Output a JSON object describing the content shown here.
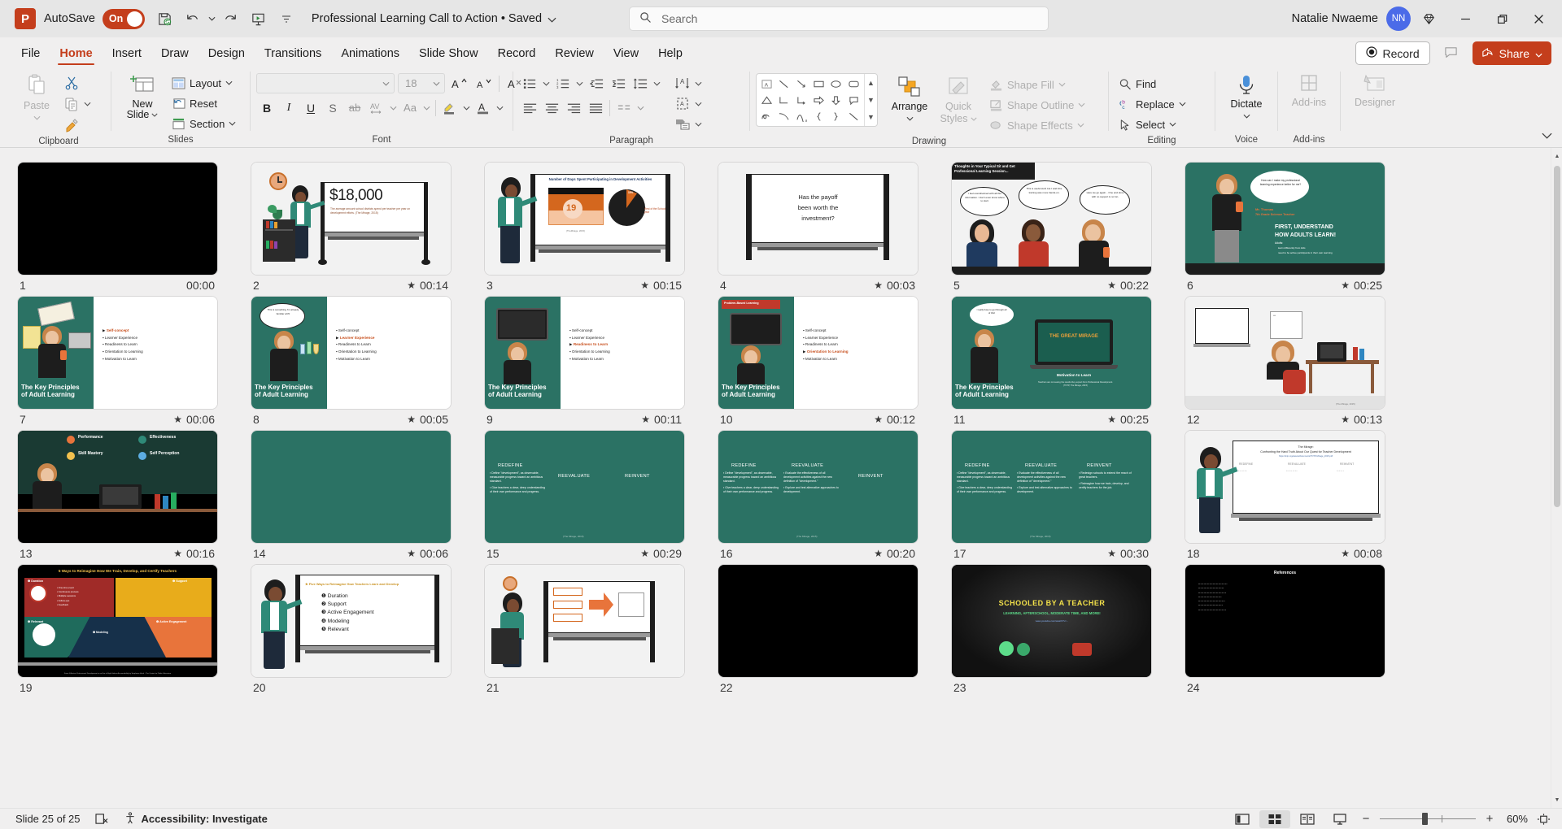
{
  "titlebar": {
    "app_icon": "powerpoint-logo",
    "autosave_label": "AutoSave",
    "autosave_state": "On",
    "save_icon": "save-icon",
    "undo_icon": "undo-icon",
    "redo_icon": "redo-icon",
    "present_icon": "start-presentation-icon",
    "customize_icon": "customize-quick-access-icon",
    "document_title": "Professional Learning Call to Action • Saved",
    "search_placeholder": "Search",
    "search_icon": "search-icon",
    "user_name": "Natalie Nwaeme",
    "user_initials": "NN",
    "diamond_icon": "diamond-icon",
    "minimize": "minimize-icon",
    "restore": "restore-icon",
    "close": "close-icon"
  },
  "tabs": [
    {
      "label": "File",
      "active": false
    },
    {
      "label": "Home",
      "active": true
    },
    {
      "label": "Insert",
      "active": false
    },
    {
      "label": "Draw",
      "active": false
    },
    {
      "label": "Design",
      "active": false
    },
    {
      "label": "Transitions",
      "active": false
    },
    {
      "label": "Animations",
      "active": false
    },
    {
      "label": "Slide Show",
      "active": false
    },
    {
      "label": "Record",
      "active": false
    },
    {
      "label": "Review",
      "active": false
    },
    {
      "label": "View",
      "active": false
    },
    {
      "label": "Help",
      "active": false
    }
  ],
  "tab_actions": {
    "record_label": "Record",
    "comments_icon": "comment-icon",
    "share_label": "Share"
  },
  "ribbon": {
    "clipboard": {
      "group_label": "Clipboard",
      "paste_label": "Paste",
      "cut_label": "Cut",
      "copy_label": "Copy",
      "format_painter_label": "Format Painter"
    },
    "slides": {
      "group_label": "Slides",
      "new_slide_line1": "New",
      "new_slide_line2": "Slide",
      "layout_label": "Layout",
      "reset_label": "Reset",
      "section_label": "Section"
    },
    "font": {
      "group_label": "Font",
      "font_name": "",
      "font_size": "18",
      "grow_font": "A",
      "shrink_font": "A",
      "clear_formatting": "clear-formatting-icon",
      "bold": "B",
      "italic": "I",
      "underline": "U",
      "shadow": "S",
      "strikethrough": "ab",
      "character_spacing": "AV",
      "change_case": "Aa",
      "highlight": "text-highlight-icon",
      "font_color": "A"
    },
    "paragraph": {
      "group_label": "Paragraph",
      "bullets": "bullets-icon",
      "numbering": "numbering-icon",
      "decrease_indent": "decrease-indent-icon",
      "increase_indent": "increase-indent-icon",
      "line_spacing": "line-spacing-icon",
      "text_direction": "text-direction-icon",
      "align_left": "align-left-icon",
      "align_center": "align-center-icon",
      "align_right": "align-right-icon",
      "justify": "justify-icon",
      "columns": "columns-icon",
      "align_text": "align-text-icon",
      "smartart": "convert-to-smartart-icon"
    },
    "drawing": {
      "group_label": "Drawing",
      "arrange_label": "Arrange",
      "quick_styles_line1": "Quick",
      "quick_styles_line2": "Styles",
      "shape_fill_label": "Shape Fill",
      "shape_outline_label": "Shape Outline",
      "shape_effects_label": "Shape Effects"
    },
    "editing": {
      "group_label": "Editing",
      "find_label": "Find",
      "replace_label": "Replace",
      "select_label": "Select"
    },
    "voice": {
      "group_label": "Voice",
      "dictate_label": "Dictate"
    },
    "addins": {
      "group_label": "Add-ins",
      "addins_label": "Add-ins"
    },
    "designer": {
      "designer_label": "Designer"
    },
    "collapse_icon": "collapse-ribbon-icon"
  },
  "slides": [
    {
      "number": "1",
      "time": "00:00",
      "has_star": false,
      "type": "black"
    },
    {
      "number": "2",
      "time": "00:14",
      "has_star": true,
      "type": "whiteboard-money",
      "heading": "$18,000",
      "sub": "The average amount school districts spend per teacher per year on development efforts. (The Mirage, 2015)"
    },
    {
      "number": "3",
      "time": "00:15",
      "has_star": true,
      "type": "whiteboard-chart",
      "heading": "Number of Days Spent Participating in Development Activities",
      "value": "19",
      "slice_label": "10%",
      "note": "Rest of the School year",
      "cite": "(TheMirage, 2015)"
    },
    {
      "number": "4",
      "time": "00:03",
      "has_star": true,
      "type": "whiteboard-question",
      "line1": "Has the payoff",
      "line2": "been worth the",
      "line3": "investment?"
    },
    {
      "number": "5",
      "time": "00:22",
      "has_star": true,
      "type": "comic",
      "banner": "Thoughts in Your Typical Sit and Get Professional Learning Session...",
      "bubble1": "I feel overwhelmed with all this information. I don't even know where to start.",
      "bubble2": "This is useful stuff, but I wish this training was more hands-on.",
      "bubble3": "Here we go again... One and done with no support is no fun."
    },
    {
      "number": "6",
      "time": "00:25",
      "has_star": true,
      "type": "green-intro",
      "bubble": "How can I make my professional learning experience better for me?",
      "name": "Mr. Thomas",
      "role": "7th Grade Science Teacher",
      "title1": "FIRST, UNDERSTAND",
      "title2": "HOW ADULTS LEARN!",
      "sub": "Adults:",
      "b1": "learn differently from kids",
      "b2": "need to be active participants in their own learning"
    },
    {
      "number": "7",
      "time": "00:06",
      "has_star": true,
      "type": "key-principles",
      "highlight": 0,
      "title1": "The Key Principles",
      "title2": "of Adult Learning",
      "bullets": [
        "Self-concept",
        "Learner Experience",
        "Readiness to Learn",
        "Orientation to Learning",
        "Motivation to Learn"
      ]
    },
    {
      "number": "8",
      "time": "00:05",
      "has_star": true,
      "type": "key-principles",
      "highlight": 1,
      "title1": "The Key Principles",
      "title2": "of Adult Learning",
      "bubble": "This is something I'm already familiar with!",
      "bullets": [
        "Self-concept",
        "Learner Experience",
        "Readiness to Learn",
        "Orientation to Learning",
        "Motivation to Learn"
      ]
    },
    {
      "number": "9",
      "time": "00:11",
      "has_star": true,
      "type": "key-principles",
      "highlight": 2,
      "title1": "The Key Principles",
      "title2": "of Adult Learning",
      "bullets": [
        "Self-concept",
        "Learner Experience",
        "Readiness to Learn",
        "Orientation to Learning",
        "Motivation to Learn"
      ]
    },
    {
      "number": "10",
      "time": "00:12",
      "has_star": true,
      "type": "key-principles",
      "highlight": 3,
      "title1": "The Key Principles",
      "title2": "of Adult Learning",
      "badge": "Problem-Based Learning",
      "bullets": [
        "Self-concept",
        "Learner Experience",
        "Readiness to Learn",
        "Orientation to Learning",
        "Motivation to Learn"
      ]
    },
    {
      "number": "11",
      "time": "00:25",
      "has_star": true,
      "type": "motivation",
      "title1": "The Key Principles",
      "title2": "of Adult Learning",
      "bubble": "I really have to get through all of this!",
      "screen_title": "THE GREAT MIRAGE",
      "caption": "Motivation to Learn",
      "sub": "Teachers are not seeing the results they expect from Professional Development. (TNTP, The Mirage, 2015)"
    },
    {
      "number": "12",
      "time": "00:13",
      "has_star": true,
      "type": "classroom-desk",
      "cite": "(The Mirage, 2015)"
    },
    {
      "number": "13",
      "time": "00:16",
      "has_star": true,
      "type": "four-labels",
      "l1": "Performance",
      "l2": "Effectiveness",
      "l3": "Skill Mastery",
      "l4": "Self Perception"
    },
    {
      "number": "14",
      "time": "00:06",
      "has_star": true,
      "type": "green-blank"
    },
    {
      "number": "15",
      "time": "00:29",
      "has_star": true,
      "type": "three-r",
      "filled": 1,
      "h1": "REDEFINE",
      "h2": "REEVALUATE",
      "h3": "REINVENT",
      "c1": [
        "Define \"development\", as observable, measurable progress toward an ambitious standard.",
        "Give teachers a clear, deep understanding of their own performance and progress."
      ],
      "c2": [],
      "c3": [],
      "cite": "(The Mirage, 2015)"
    },
    {
      "number": "16",
      "time": "00:20",
      "has_star": true,
      "type": "three-r",
      "filled": 2,
      "h1": "REDEFINE",
      "h2": "REEVALUATE",
      "h3": "REINVENT",
      "c1": [
        "Define \"development\", as observable, measurable progress toward an ambitious standard.",
        "Give teachers a clear, deep understanding of their own performance and progress."
      ],
      "c2": [
        "Evaluate the effectiveness of all development activities against the new definition of \"development.\"",
        "Explore and test alternative approaches to development."
      ],
      "c3": [],
      "cite": "(The Mirage, 2015)"
    },
    {
      "number": "17",
      "time": "00:30",
      "has_star": true,
      "type": "three-r",
      "filled": 3,
      "h1": "REDEFINE",
      "h2": "REEVALUATE",
      "h3": "REINVENT",
      "c1": [
        "Define \"development\", as observable, measurable progress toward an ambitious standard.",
        "Give teachers a clear, deep understanding of their own performance and progress."
      ],
      "c2": [
        "Evaluate the effectiveness of all development activities against the new definition of \"development.\"",
        "Explore and test alternative approaches to development."
      ],
      "c3": [
        "Redesign schools to extend the reach of great teachers.",
        "Reimagine how we train, develop, and certify teachers for the job."
      ],
      "cite": "(The Mirage, 2015)"
    },
    {
      "number": "18",
      "time": "00:08",
      "has_star": true,
      "type": "whiteboard-three-r",
      "title1": "The Mirage:",
      "title2": "Confronting the Hard Truth About Our Quest for Teacher Development",
      "url": "https://tntp.org/assets/documents/TNTP-Mirage_2015.pdf",
      "h1": "REDEFINE",
      "h2": "REEVALUATE",
      "h3": "REINVENT"
    },
    {
      "number": "19",
      "time": "",
      "has_star": false,
      "type": "five-ways-infographic",
      "title": "5 Ways to Reimagine How We Train, Develop, and Certify Teachers",
      "q1": "Duration",
      "q2": "Support",
      "q3": "Relevant",
      "q4": "Active Engagement",
      "q5": "Modeling",
      "d1": "One-time event",
      "d2": "Continuous process",
      "d3": "Multiple sessions",
      "d4": "Follow-ups",
      "d5": "Feedback",
      "foot": "From: Effective Professional Development in an Era of High-Stakes Accountability by Stephanie Hirsh - The Center for Public Education"
    },
    {
      "number": "20",
      "time": "",
      "has_star": false,
      "type": "whiteboard-five",
      "title": "Five Ways to Reimagine How Teachers Learn and Develop",
      "items": [
        "Duration",
        "Support",
        "Active Engagement",
        "Modeling",
        "Relevant"
      ]
    },
    {
      "number": "21",
      "time": "",
      "has_star": false,
      "type": "whiteboard-cycle"
    },
    {
      "number": "22",
      "time": "",
      "has_star": false,
      "type": "black"
    },
    {
      "number": "23",
      "time": "",
      "has_star": false,
      "type": "video-dark",
      "title": "SCHOOLED BY A TEACHER",
      "sub": "LEARNING, AFTERSCHOOL, MODERATE TIME, AND MORE!",
      "url": "www.youtube.com/watch?v=..."
    },
    {
      "number": "24",
      "time": "",
      "has_star": false,
      "type": "references",
      "title": "References"
    }
  ],
  "statusbar": {
    "slide_counter": "Slide 25 of 25",
    "notes_icon": "notes-icon",
    "accessibility_icon": "accessibility-icon",
    "accessibility_label": "Accessibility: Investigate",
    "view_normal": "normal-view-icon",
    "view_sorter": "slide-sorter-icon",
    "view_reading": "reading-view-icon",
    "view_slideshow": "slideshow-view-icon",
    "zoom_out": "−",
    "zoom_in": "+",
    "zoom_level": "60%",
    "fit_icon": "fit-to-window-icon"
  },
  "colors": {
    "accent": "#C43E1C",
    "brand_green": "#2B7264",
    "avatar": "#4B6BE8"
  }
}
